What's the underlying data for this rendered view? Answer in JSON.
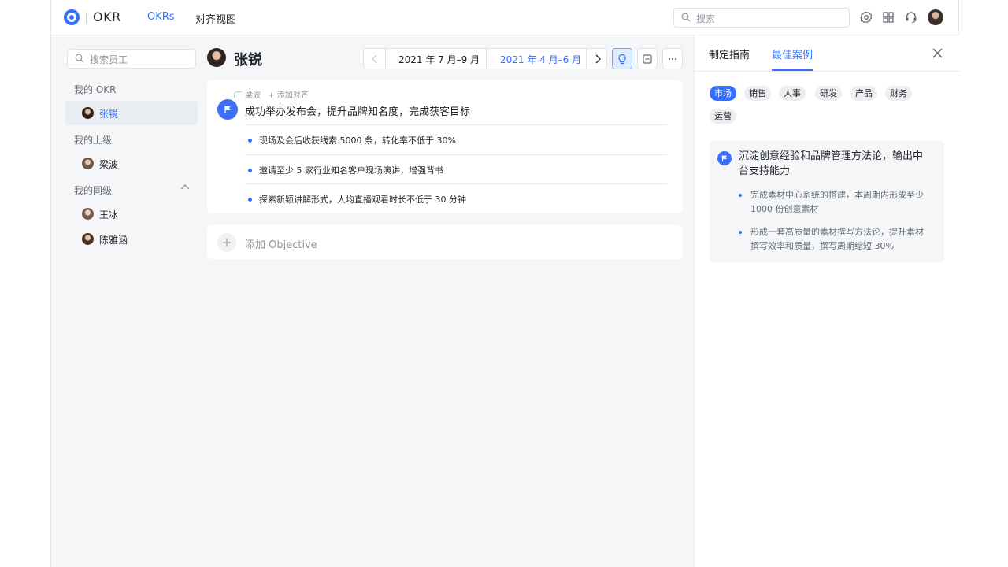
{
  "header": {
    "app_name": "OKR",
    "tabs": [
      {
        "label": "OKRs",
        "active": true
      },
      {
        "label": "对齐视图",
        "active": false
      }
    ],
    "search_placeholder": "搜索",
    "icons": [
      "settings-icon",
      "apps-grid-icon",
      "headset-icon",
      "user-avatar"
    ]
  },
  "sidebar": {
    "search_placeholder": "搜索员工",
    "sections": [
      {
        "label": "我的 OKR",
        "people": [
          {
            "name": "张锐",
            "active": true
          }
        ]
      },
      {
        "label": "我的上级",
        "people": [
          {
            "name": "梁波",
            "active": false
          }
        ]
      },
      {
        "label": "我的同级",
        "collapsible": true,
        "people": [
          {
            "name": "王冰",
            "active": false
          },
          {
            "name": "陈雅涵",
            "active": false
          }
        ]
      }
    ]
  },
  "main": {
    "owner_name": "张锐",
    "periods": [
      {
        "label": "2021 年 7 月–9 月",
        "active": false
      },
      {
        "label": "2021 年 4 月–6 月",
        "active": true
      }
    ],
    "objective": {
      "aligned_to": "梁波",
      "add_alignment": "添加对齐",
      "title": "成功举办发布会，提升品牌知名度，完成获客目标",
      "key_results": [
        "现场及会后收获线索 5000 条，转化率不低于 30%",
        "邀请至少 5 家行业知名客户现场演讲，增强背书",
        "探索新颖讲解形式，人均直播观看时长不低于 30 分钟"
      ]
    },
    "add_objective_label": "添加 Objective"
  },
  "panel": {
    "tabs": [
      {
        "label": "制定指南",
        "active": false
      },
      {
        "label": "最佳案例",
        "active": true
      }
    ],
    "categories": [
      {
        "label": "市场",
        "active": true
      },
      {
        "label": "销售",
        "active": false
      },
      {
        "label": "人事",
        "active": false
      },
      {
        "label": "研发",
        "active": false
      },
      {
        "label": "产品",
        "active": false
      },
      {
        "label": "财务",
        "active": false
      },
      {
        "label": "运营",
        "active": false
      }
    ],
    "case": {
      "title": "沉淀创意经验和品牌管理方法论，输出中台支持能力",
      "key_results": [
        "完成素材中心系统的搭建，本周期内形成至少 1000 份创意素材",
        "形成一套高质量的素材撰写方法论，提升素材撰写效率和质量，撰写周期缩短 30%"
      ]
    }
  },
  "colors": {
    "accent": "#3370ff",
    "flag": "#3d6ef5",
    "page_bg": "#f5f6f7"
  }
}
